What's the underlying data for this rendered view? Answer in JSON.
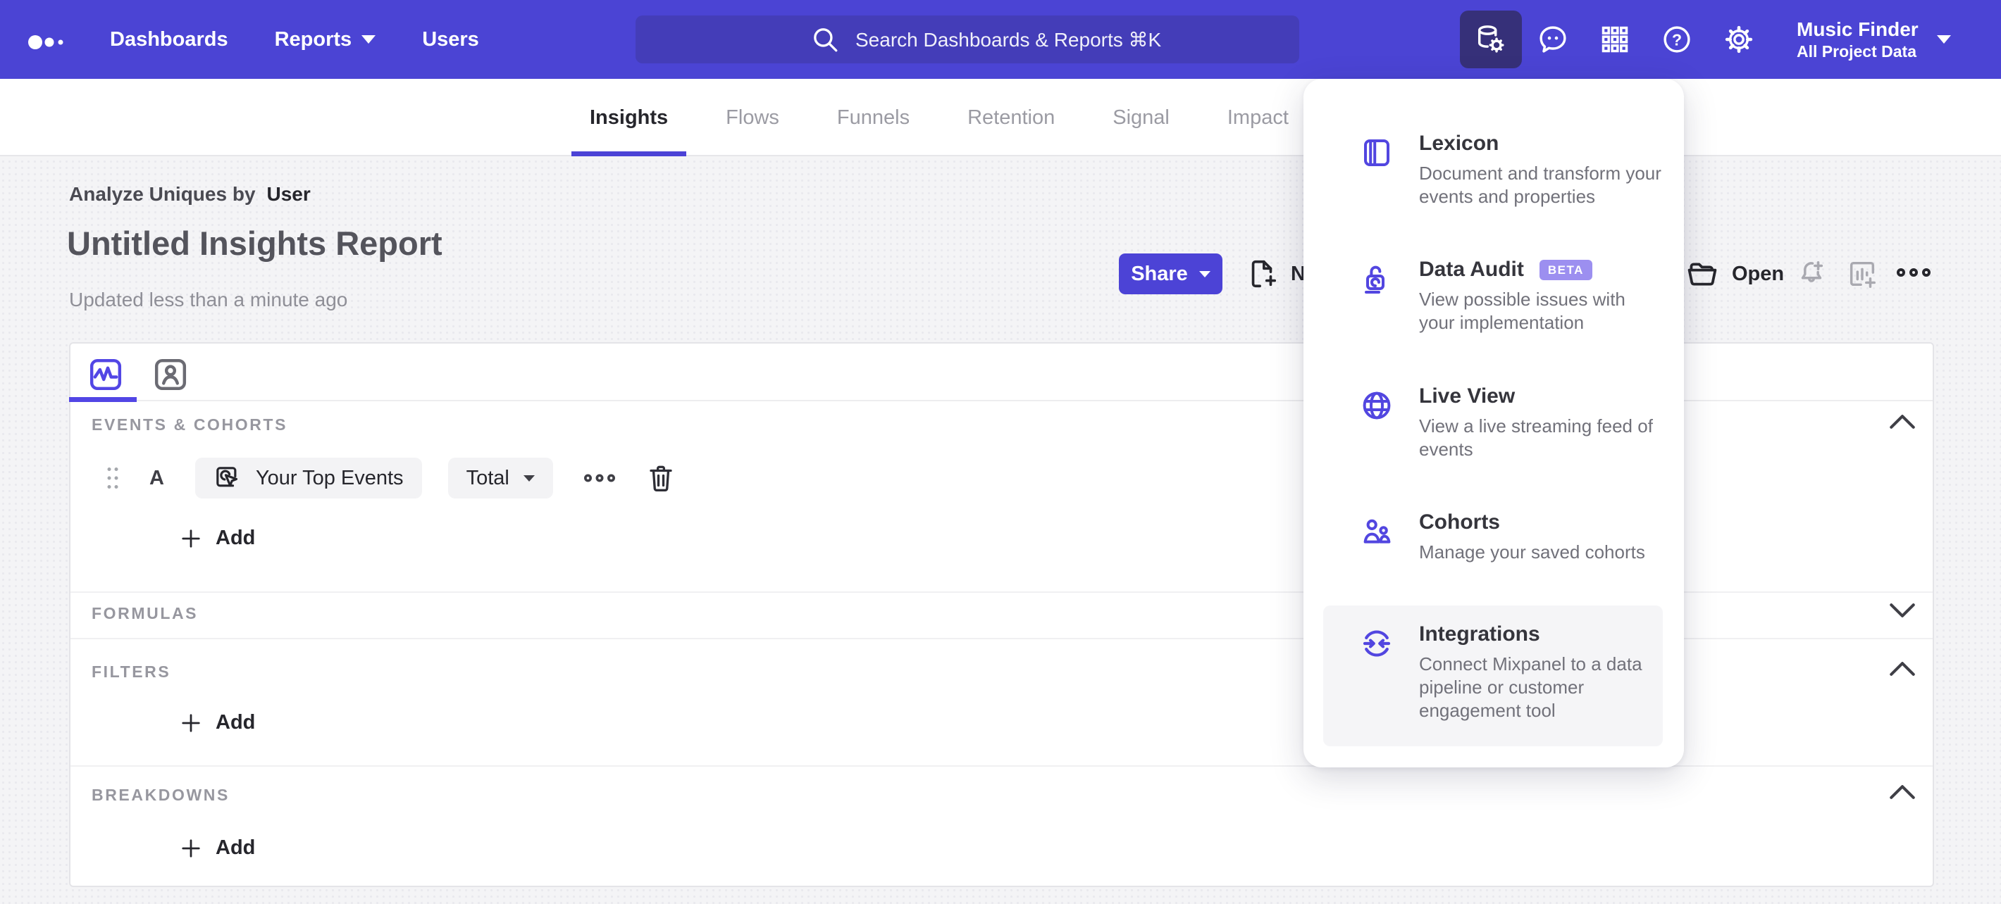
{
  "nav": {
    "items": [
      {
        "label": "Dashboards",
        "has_caret": false
      },
      {
        "label": "Reports",
        "has_caret": true
      },
      {
        "label": "Users",
        "has_caret": false
      }
    ],
    "search": {
      "placeholder": "Search Dashboards & Reports ⌘K"
    },
    "icon_buttons": [
      "data-management",
      "feedback",
      "apps-grid",
      "help",
      "settings"
    ],
    "project": {
      "name": "Music Finder",
      "scope": "All Project Data"
    }
  },
  "tabs": {
    "items": [
      {
        "label": "Insights",
        "active": true
      },
      {
        "label": "Flows",
        "active": false
      },
      {
        "label": "Funnels",
        "active": false
      },
      {
        "label": "Retention",
        "active": false
      },
      {
        "label": "Signal",
        "active": false
      },
      {
        "label": "Impact",
        "active": false
      }
    ]
  },
  "report_header": {
    "analyze_prefix": "Analyze Uniques by",
    "analyze_value": "User",
    "title": "Untitled Insights Report",
    "updated": "Updated less than a minute ago",
    "share_label": "Share",
    "new_label": "New",
    "open_label": "Open"
  },
  "tools_menu": {
    "items": [
      {
        "name": "Lexicon",
        "description": "Document and transform your events and properties"
      },
      {
        "name": "Data Audit",
        "badge": "BETA",
        "description": "View possible issues with your implementation"
      },
      {
        "name": "Live View",
        "description": "View a live streaming feed of events"
      },
      {
        "name": "Cohorts",
        "description": "Manage your saved cohorts"
      },
      {
        "name": "Integrations",
        "description": "Connect Mixpanel to a data pipeline or customer engagement tool",
        "highlighted": true
      }
    ]
  },
  "query_builder": {
    "events": {
      "title": "EVENTS & COHORTS",
      "row": {
        "letter": "A",
        "event": "Your Top Events",
        "aggregation": "Total"
      },
      "add_label": "Add",
      "collapsed": false
    },
    "formulas": {
      "title": "FORMULAS",
      "collapsed": true
    },
    "filters": {
      "title": "FILTERS",
      "add_label": "Add",
      "collapsed": false
    },
    "breakdowns": {
      "title": "BREAKDOWNS",
      "add_label": "Add",
      "collapsed": false
    }
  },
  "colors": {
    "nav_purple": "#4B44D4",
    "search_bg": "#443DB8",
    "active_icon_bg": "#363079",
    "accent_purple": "#5246E0",
    "share_button": "#4C43D6",
    "beta_badge": "#9C8FF0",
    "page_bg": "#F4F4F6",
    "section_label": "#97979F"
  }
}
